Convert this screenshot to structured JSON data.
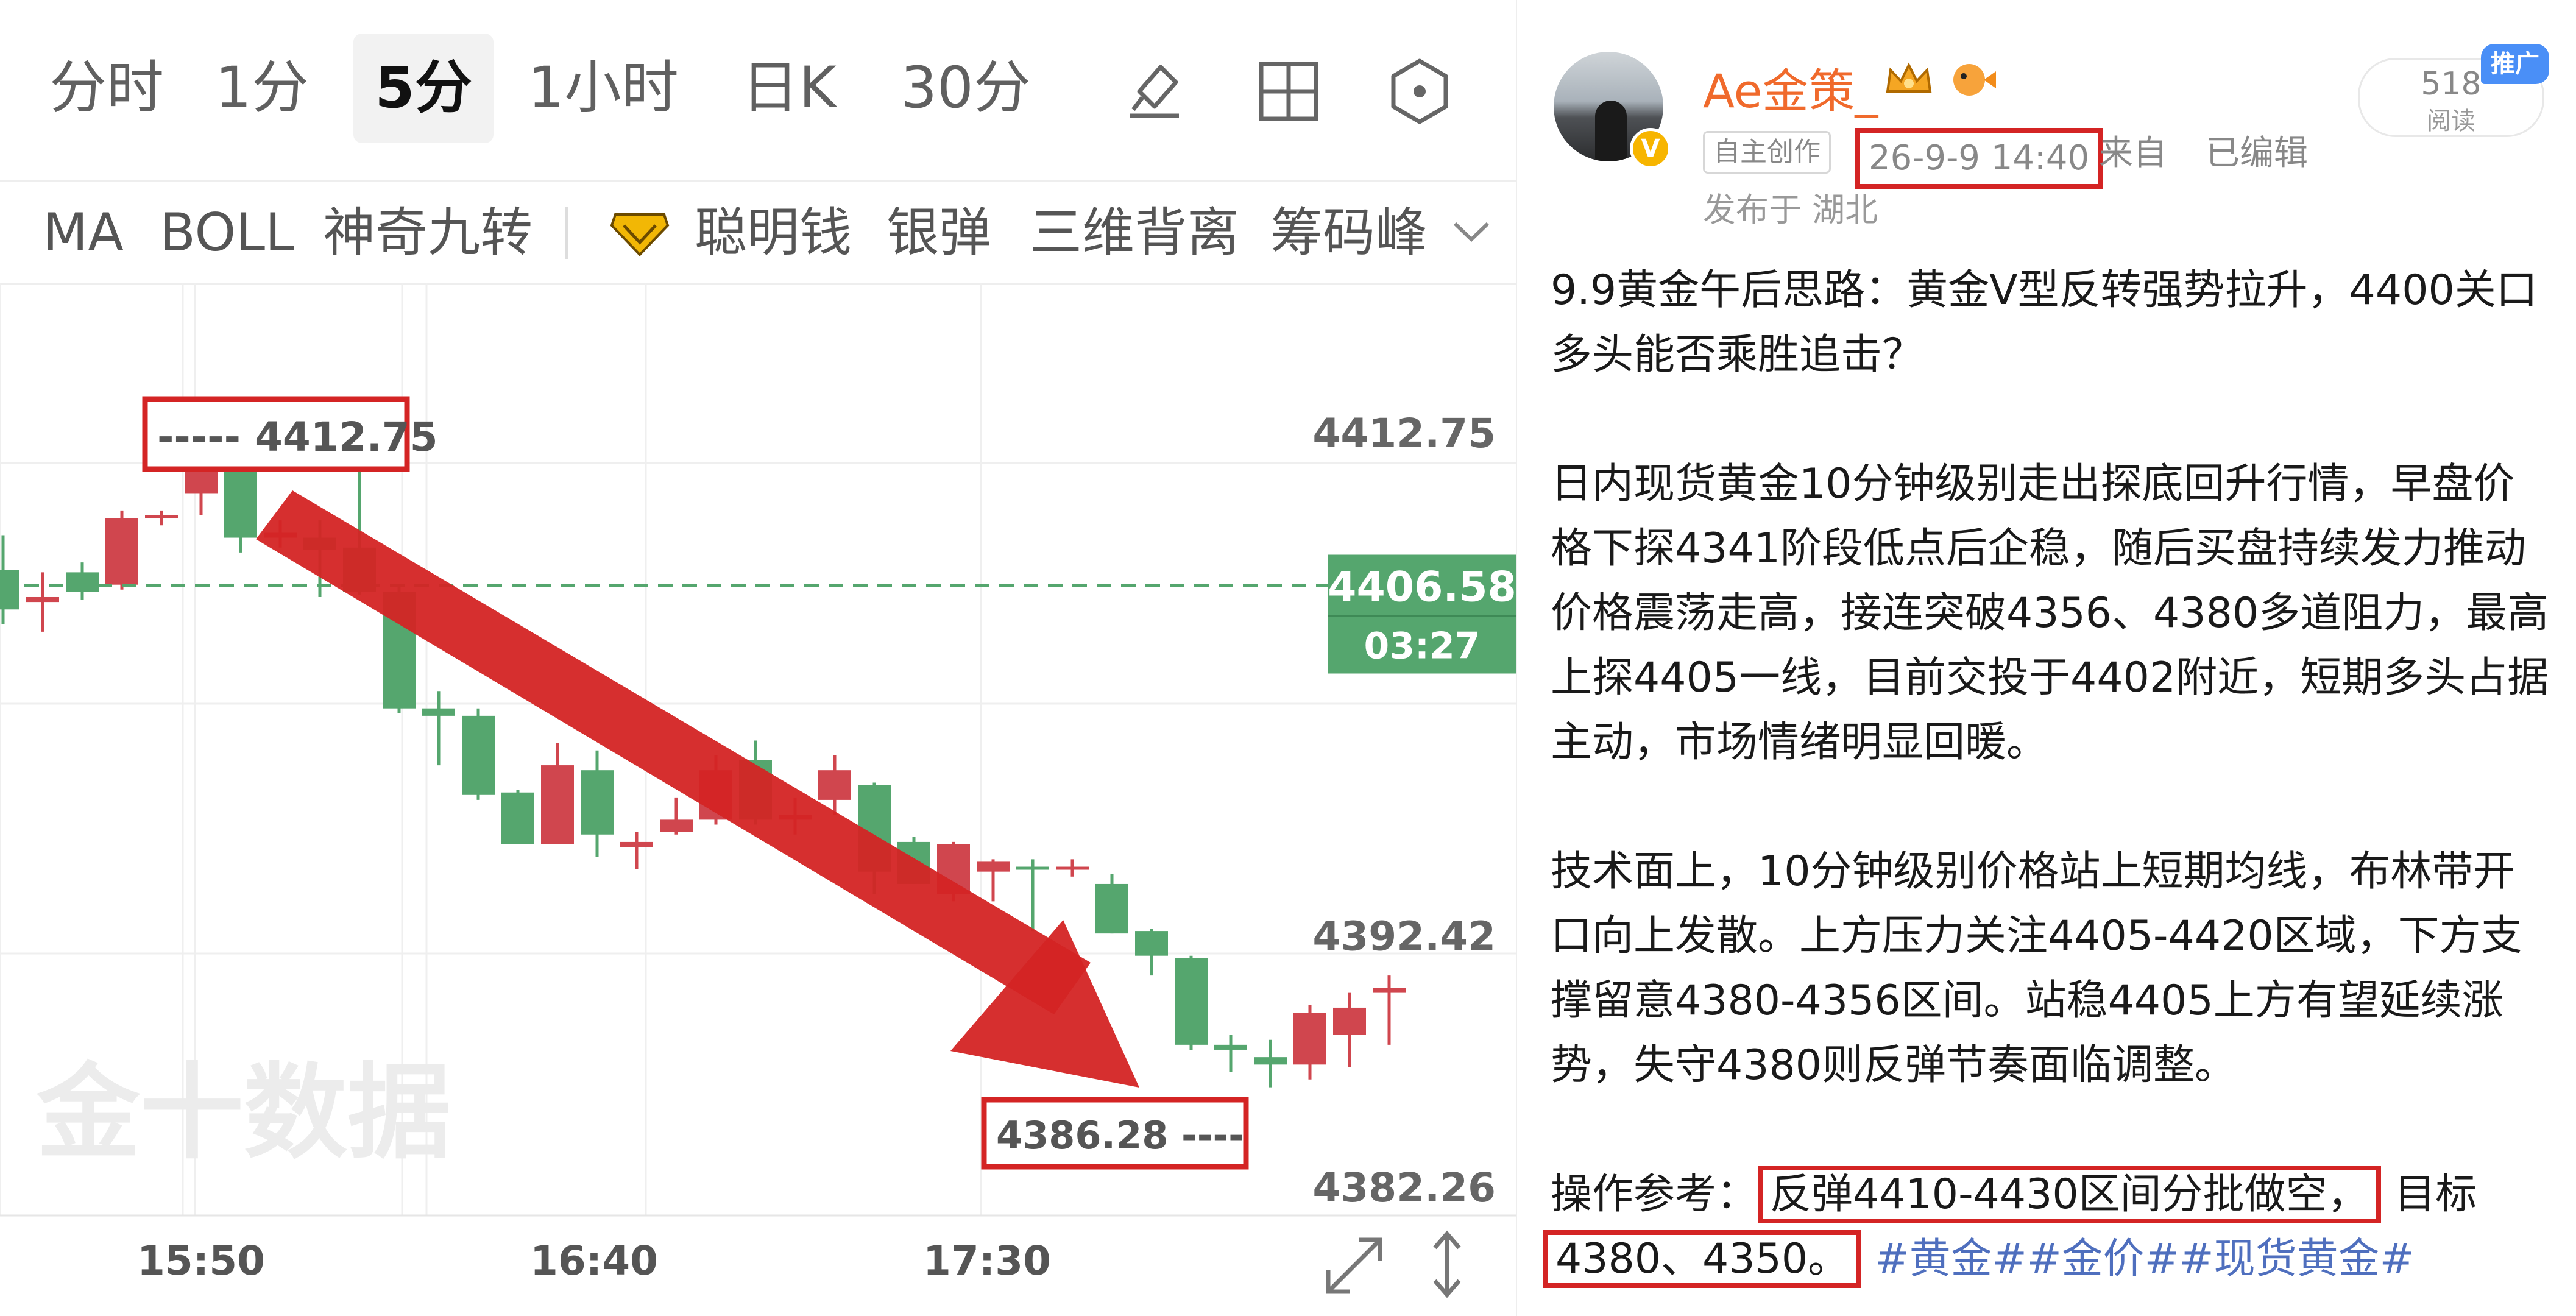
{
  "timeframe_tabs": [
    {
      "label": "分时",
      "active": false
    },
    {
      "label": "1分",
      "active": false
    },
    {
      "label": "5分",
      "active": true
    },
    {
      "label": "1小时",
      "active": false
    },
    {
      "label": "日K",
      "active": false
    },
    {
      "label": "30分",
      "active": false
    }
  ],
  "toolbar_icons": [
    "draw-tool-icon",
    "grid-layout-icon",
    "settings-hex-icon"
  ],
  "indicators": {
    "items": [
      "MA",
      "BOLL",
      "神奇九转",
      "聪明钱",
      "银弹",
      "三维背离",
      "筹码峰"
    ],
    "premium_icon": "diamond-vip-icon",
    "expand_icon": "chevron-down-icon"
  },
  "chart_data": {
    "type": "candlestick",
    "timeframe": "5分",
    "x_ticks": [
      "15:50",
      "16:40",
      "17:30"
    ],
    "y_ticks": [
      4412.75,
      4392.42,
      4382.26
    ],
    "current_price": "4406.58",
    "countdown": "03:27",
    "high_label": "4412.75",
    "low_label": "4386.28",
    "watermark": "金十数据",
    "up_color": "#d0464e",
    "down_color": "#55a66e",
    "candles": [
      {
        "o": 4407.2,
        "h": 4408.6,
        "l": 4405.0,
        "c": 4405.6
      },
      {
        "o": 4405.9,
        "h": 4407.1,
        "l": 4404.7,
        "c": 4406.1
      },
      {
        "o": 4407.1,
        "h": 4407.5,
        "l": 4406.0,
        "c": 4406.3
      },
      {
        "o": 4406.6,
        "h": 4409.6,
        "l": 4406.4,
        "c": 4409.3
      },
      {
        "o": 4409.4,
        "h": 4409.6,
        "l": 4409.0,
        "c": 4409.4
      },
      {
        "o": 4410.3,
        "h": 4412.75,
        "l": 4409.4,
        "c": 4411.6
      },
      {
        "o": 4411.6,
        "h": 4411.6,
        "l": 4407.9,
        "c": 4408.5
      },
      {
        "o": 4408.5,
        "h": 4409.2,
        "l": 4408.1,
        "c": 4408.7
      },
      {
        "o": 4408.5,
        "h": 4409.2,
        "l": 4406.1,
        "c": 4408.0
      },
      {
        "o": 4408.1,
        "h": 4411.4,
        "l": 4406.2,
        "c": 4406.3
      },
      {
        "o": 4406.3,
        "h": 4406.6,
        "l": 4401.4,
        "c": 4401.6
      },
      {
        "o": 4401.6,
        "h": 4402.3,
        "l": 4399.3,
        "c": 4401.3
      },
      {
        "o": 4401.3,
        "h": 4401.6,
        "l": 4397.9,
        "c": 4398.1
      },
      {
        "o": 4398.2,
        "h": 4398.3,
        "l": 4396.1,
        "c": 4396.1
      },
      {
        "o": 4396.1,
        "h": 4400.2,
        "l": 4396.1,
        "c": 4399.3
      },
      {
        "o": 4399.1,
        "h": 4399.9,
        "l": 4395.6,
        "c": 4396.5
      },
      {
        "o": 4396.0,
        "h": 4396.6,
        "l": 4395.1,
        "c": 4396.2
      },
      {
        "o": 4396.6,
        "h": 4398.0,
        "l": 4396.5,
        "c": 4397.1
      },
      {
        "o": 4397.1,
        "h": 4399.7,
        "l": 4396.9,
        "c": 4399.1
      },
      {
        "o": 4399.5,
        "h": 4400.3,
        "l": 4396.9,
        "c": 4397.1
      },
      {
        "o": 4397.1,
        "h": 4398.0,
        "l": 4396.5,
        "c": 4397.3
      },
      {
        "o": 4397.9,
        "h": 4399.7,
        "l": 4397.3,
        "c": 4399.1
      },
      {
        "o": 4398.5,
        "h": 4398.6,
        "l": 4394.1,
        "c": 4395.0
      },
      {
        "o": 4396.2,
        "h": 4396.4,
        "l": 4394.5,
        "c": 4394.5
      },
      {
        "o": 4394.1,
        "h": 4396.2,
        "l": 4393.8,
        "c": 4396.1
      },
      {
        "o": 4395.0,
        "h": 4395.5,
        "l": 4393.8,
        "c": 4395.4
      },
      {
        "o": 4395.2,
        "h": 4395.5,
        "l": 4392.6,
        "c": 4395.1
      },
      {
        "o": 4395.2,
        "h": 4395.5,
        "l": 4394.8,
        "c": 4395.2
      },
      {
        "o": 4394.5,
        "h": 4394.9,
        "l": 4392.5,
        "c": 4392.5
      },
      {
        "o": 4392.6,
        "h": 4392.7,
        "l": 4390.8,
        "c": 4391.6
      },
      {
        "o": 4391.5,
        "h": 4391.6,
        "l": 4387.8,
        "c": 4388.0
      },
      {
        "o": 4388.0,
        "h": 4388.4,
        "l": 4386.9,
        "c": 4387.8
      },
      {
        "o": 4387.5,
        "h": 4388.2,
        "l": 4386.28,
        "c": 4387.2
      },
      {
        "o": 4387.2,
        "h": 4389.6,
        "l": 4386.6,
        "c": 4389.3
      },
      {
        "o": 4388.4,
        "h": 4390.1,
        "l": 4387.1,
        "c": 4389.5
      },
      {
        "o": 4390.1,
        "h": 4390.8,
        "l": 4388.0,
        "c": 4390.3
      }
    ]
  },
  "chart_controls": [
    "expand-icon",
    "vertical-resize-icon"
  ],
  "post": {
    "username": "Ae金策_",
    "read_count": "518",
    "read_label": "阅读",
    "promo_badge": "推广",
    "original_tag": "自主创作",
    "timestamp": "26-9-9 14:40",
    "source": "来自",
    "edited": "已编辑",
    "location": "发布于 湖北",
    "title": "9.9黄金午后思路：黄金Ⅴ型反转强势拉升，4400关口多头能否乘胜追击？",
    "paragraph1": "日内现货黄金10分钟级别走出探底回升行情，早盘价格下探4341阶段低点后企稳，随后买盘持续发力推动价格震荡走高，接连突破4356、4380多道阻力，最高上探4405一线，目前交投于4402附近，短期多头占据主动，市场情绪明显回暖。",
    "paragraph2": "技术面上，10分钟级别价格站上短期均线，布林带开口向上发散。上方压力关注4405-4420区域，下方支撑留意4380-4356区间。站稳4405上方有望延续涨势，失守4380则反弹节奏面临调整。",
    "op_label": "操作参考：",
    "op_box": "反弹4410-4430区间分批做空，",
    "op_target": "目标",
    "op_targets": "4380、4350。",
    "hashtags": "#黄金##金价##现货黄金#"
  }
}
